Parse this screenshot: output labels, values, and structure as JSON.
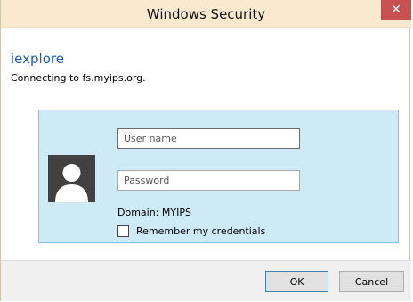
{
  "window": {
    "title": "Windows Security",
    "close_glyph": "✕"
  },
  "app": {
    "name": "iexplore",
    "connecting_text": "Connecting to fs.myips.org."
  },
  "credentials": {
    "avatar_icon": "user-icon",
    "username": {
      "value": "",
      "placeholder": "User name"
    },
    "password": {
      "value": "",
      "placeholder": "Password"
    },
    "domain_text": "Domain: MYIPS",
    "remember": {
      "label": "Remember my credentials",
      "checked": false
    }
  },
  "buttons": {
    "ok_label": "OK",
    "cancel_label": "Cancel"
  },
  "colors": {
    "titlebar": "#fbe9cf",
    "close_button": "#c75050",
    "app_name": "#1c5fb0",
    "credential_panel": "#cfeaf7",
    "credential_border": "#7fc4e6",
    "avatar": "#414141"
  }
}
